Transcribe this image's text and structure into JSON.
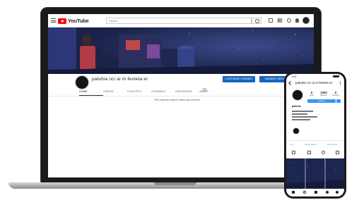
{
  "youtube": {
    "logo_text": "YouTube",
    "search_placeholder": "Search",
    "channel_name": "paluhia nci ai m festeta er",
    "buttons": {
      "customize": "CUSTOMIZE CHANNEL",
      "manage": "MANAGE VIDEOS"
    },
    "tabs": [
      "HOME",
      "VIDEOS",
      "PLAYLISTS",
      "CHANNELS",
      "DISCUSSION",
      "ABOUT"
    ],
    "active_tab": "HOME",
    "empty_message": "This channel doesn't have any content"
  },
  "instagram": {
    "status_time": "9:41",
    "username": "paluhia nci ai m festeta er",
    "stats": [
      {
        "value": "0",
        "label": "posts"
      },
      {
        "value": "1200",
        "label": "followers"
      },
      {
        "value": "0",
        "label": "following"
      }
    ],
    "follow_label": "Follow",
    "bio_name": "paluhia",
    "link_left": "Live",
    "link_mid": "Photo Music",
    "link_right": "Comments"
  },
  "colors": {
    "youtube_red": "#ff0000",
    "button_blue": "#1565c0",
    "instagram_blue": "#3897f0",
    "banner_sky": "#1d2650"
  }
}
